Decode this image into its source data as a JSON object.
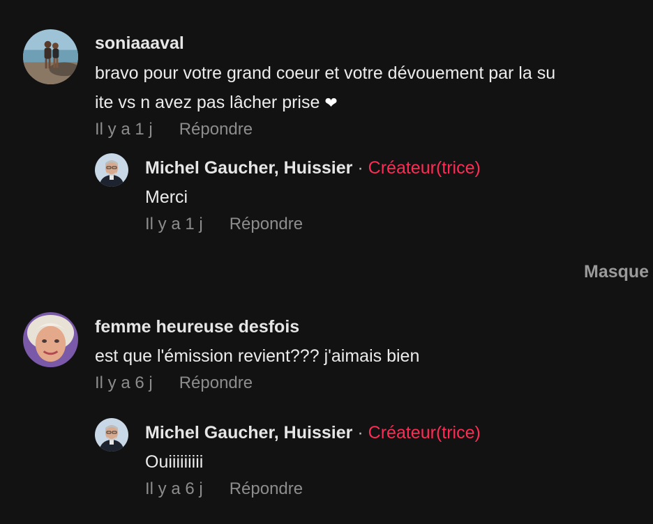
{
  "comments": [
    {
      "username": "soniaaaval",
      "text_line1": "bravo pour votre grand coeur et votre dévouement par la su",
      "text_line2": "ite vs n avez pas lâcher prise",
      "heart_icon": "heart-icon",
      "time": "Il y a 1 j",
      "reply_label": "Répondre",
      "reply": {
        "username": "Michel Gaucher, Huissier",
        "separator": "·",
        "creator_label": "Créateur(trice)",
        "text": "Merci",
        "time": "Il y a 1 j",
        "reply_label": "Répondre"
      }
    },
    {
      "username": "femme heureuse desfois",
      "text": "est que l'émission revient??? j'aimais bien",
      "time": "Il y a 6 j",
      "reply_label": "Répondre",
      "reply": {
        "username": "Michel Gaucher, Huissier",
        "separator": "·",
        "creator_label": "Créateur(trice)",
        "text": "Ouiiiiiiiii",
        "time": "Il y a 6 j",
        "reply_label": "Répondre"
      }
    }
  ],
  "hide_label": "Masque",
  "colors": {
    "background": "#121212",
    "creator_accent": "#fe2c55",
    "meta_text": "#8d8d8d"
  }
}
